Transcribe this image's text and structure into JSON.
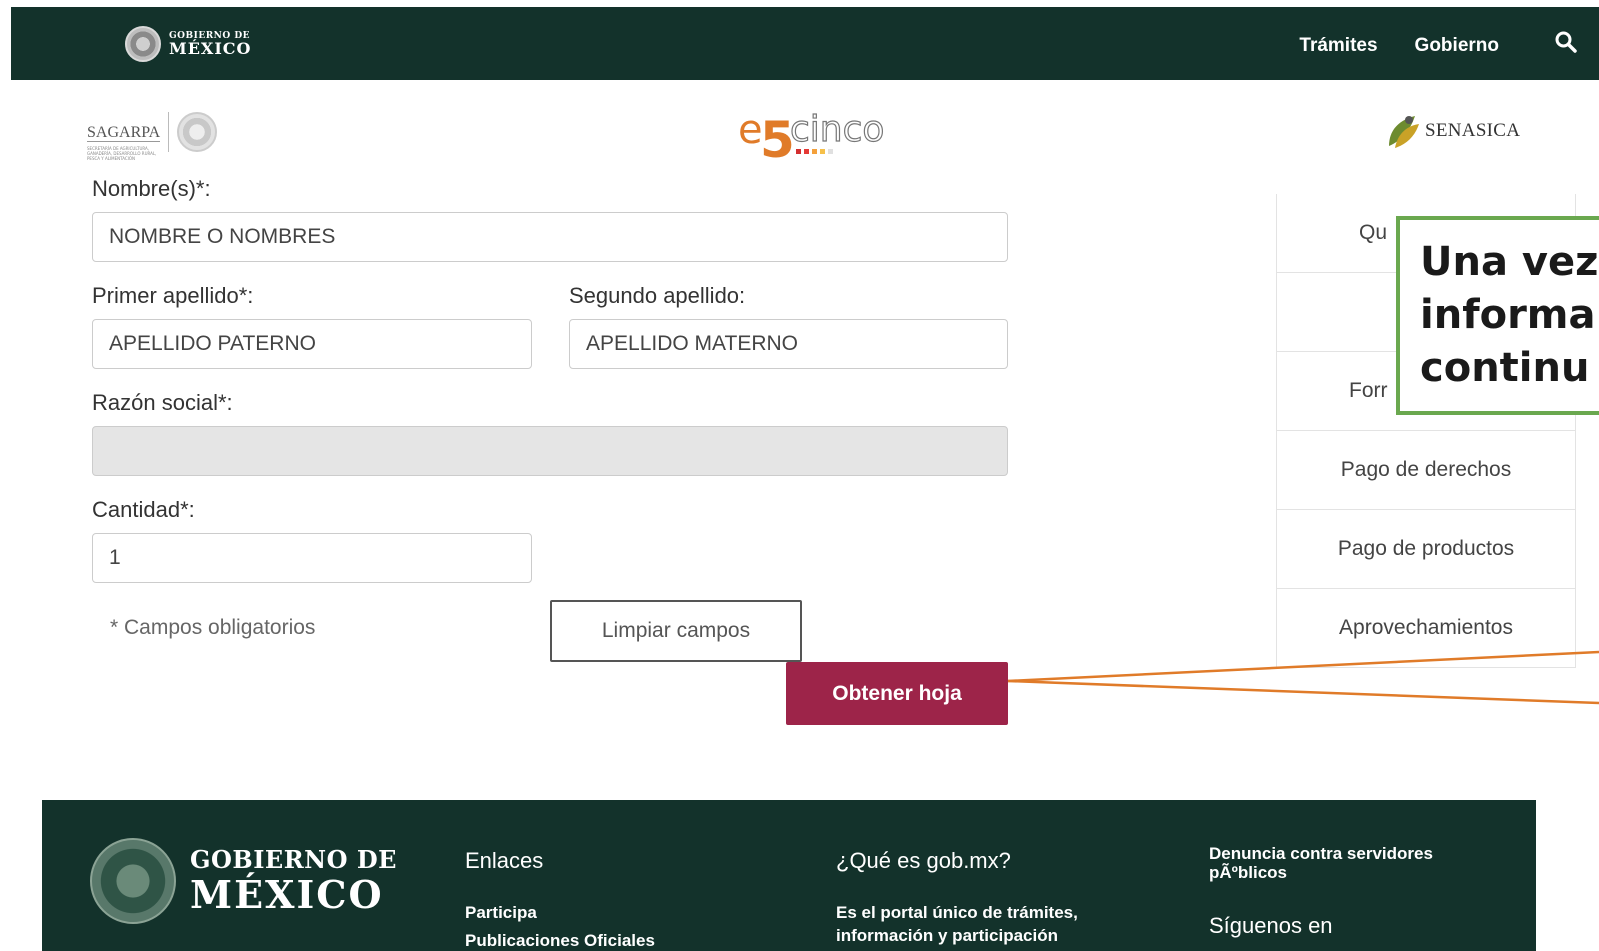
{
  "navbar": {
    "logo_line1": "GOBIERNO DE",
    "logo_line2": "MÉXICO",
    "links": [
      "Trámites",
      "Gobierno"
    ],
    "search_icon": "search-icon"
  },
  "header_logos": {
    "sagarpa": "SAGARPA",
    "sagarpa_sub": "SECRETARÍA DE AGRICULTURA, GANADERÍA, DESARROLLO RURAL, PESCA Y ALIMENTACIÓN",
    "e5cinco": "e5cinco",
    "senasica": "SENASICA"
  },
  "form": {
    "nombre_label": "Nombre(s)*:",
    "nombre_value": "NOMBRE O NOMBRES",
    "primer_label": "Primer apellido*:",
    "primer_value": "APELLIDO PATERNO",
    "segundo_label": "Segundo apellido:",
    "segundo_value": "APELLIDO MATERNO",
    "razon_label": "Razón social*:",
    "razon_value": "",
    "cantidad_label": "Cantidad*:",
    "cantidad_value": "1",
    "required_note": "* Campos obligatorios",
    "clear_label": "Limpiar campos",
    "submit_label": "Obtener hoja"
  },
  "side_menu": {
    "items": [
      "Qu",
      "",
      "Forr",
      "Pago de derechos",
      "Pago de productos",
      "Aprovechamientos"
    ]
  },
  "callout": {
    "lines": [
      "Una vez",
      "informa",
      "continu"
    ],
    "border_color": "#6aa84f"
  },
  "arrow_color": "#e07b29",
  "footer": {
    "logo_line1": "GOBIERNO DE",
    "logo_line2": "MÉXICO",
    "enlaces_heading": "Enlaces",
    "enlaces": [
      "Participa",
      "Publicaciones Oficiales"
    ],
    "que_es_heading": "¿Qué es gob.mx?",
    "que_es_text": [
      "Es el portal único de trámites,",
      "información y participación"
    ],
    "denuncia": [
      "Denuncia contra servidores",
      "pÃºblicos"
    ],
    "siguenos": "Síguenos en"
  },
  "colors": {
    "navbar_bg": "#13322b",
    "primary_button": "#9d2449"
  }
}
